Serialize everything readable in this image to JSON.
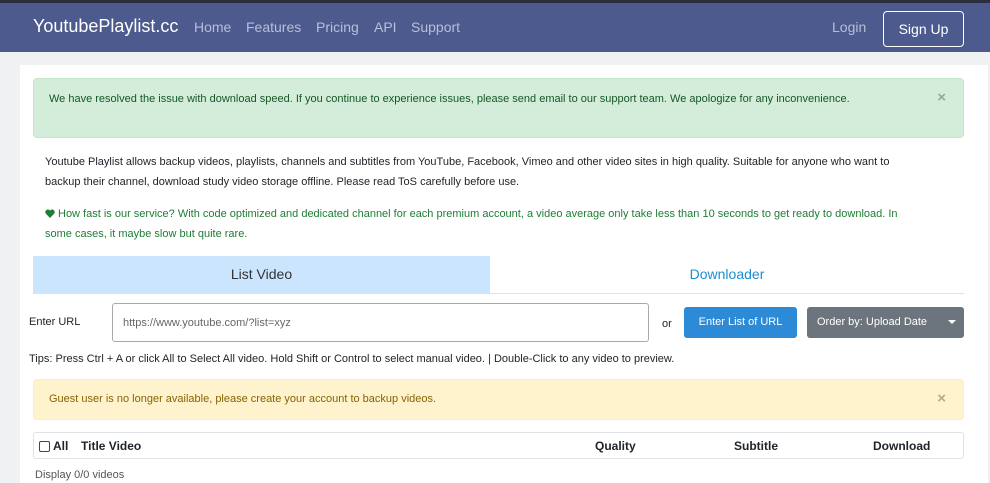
{
  "navbar": {
    "brand": "YoutubePlaylist.cc",
    "links": [
      "Home",
      "Features",
      "Pricing",
      "API",
      "Support"
    ],
    "login": "Login",
    "signup": "Sign Up"
  },
  "alerts": {
    "success": "We have resolved the issue with download speed. If you continue to experience issues, please send email to our support team. We apologize for any inconvenience.",
    "warning": "Guest user is no longer available, please create your account to backup videos.",
    "close": "×"
  },
  "intro": "Youtube Playlist allows backup videos, playlists, channels and subtitles from YouTube, Facebook, Vimeo and other video sites in high quality. Suitable for anyone who want to backup their channel, download study video storage offline. Please read ToS carefully before use.",
  "fast": {
    "icon": "heart-icon",
    "text": "How fast is our service? With code optimized and dedicated channel for each premium account, a video average only take less than 10 seconds to get ready to download. In some cases, it maybe slow but quite rare."
  },
  "tabs": [
    "List Video",
    "Downloader"
  ],
  "form": {
    "label": "Enter URL",
    "placeholder": "https://www.youtube.com/?list=xyz",
    "or": "or",
    "enter_button": "Enter List of URL",
    "order_button": "Order by: Upload Date"
  },
  "tips": "Tips: Press Ctrl + A or click All to Select All video. Hold Shift or Control to select manual video. | Double-Click to any video to preview.",
  "table": {
    "columns": [
      "All",
      "Title Video",
      "Quality",
      "Subtitle",
      "Download"
    ]
  },
  "display_count": "Display 0/0 videos",
  "colors": {
    "navbar": "#4d5a8e",
    "success_bg": "#d4edda",
    "warning_bg": "#fff3cd",
    "tab_active": "#cce5ff",
    "primary_button": "#2c8ad6",
    "secondary_button": "#6c757d",
    "fast_text": "#1e7e34"
  }
}
